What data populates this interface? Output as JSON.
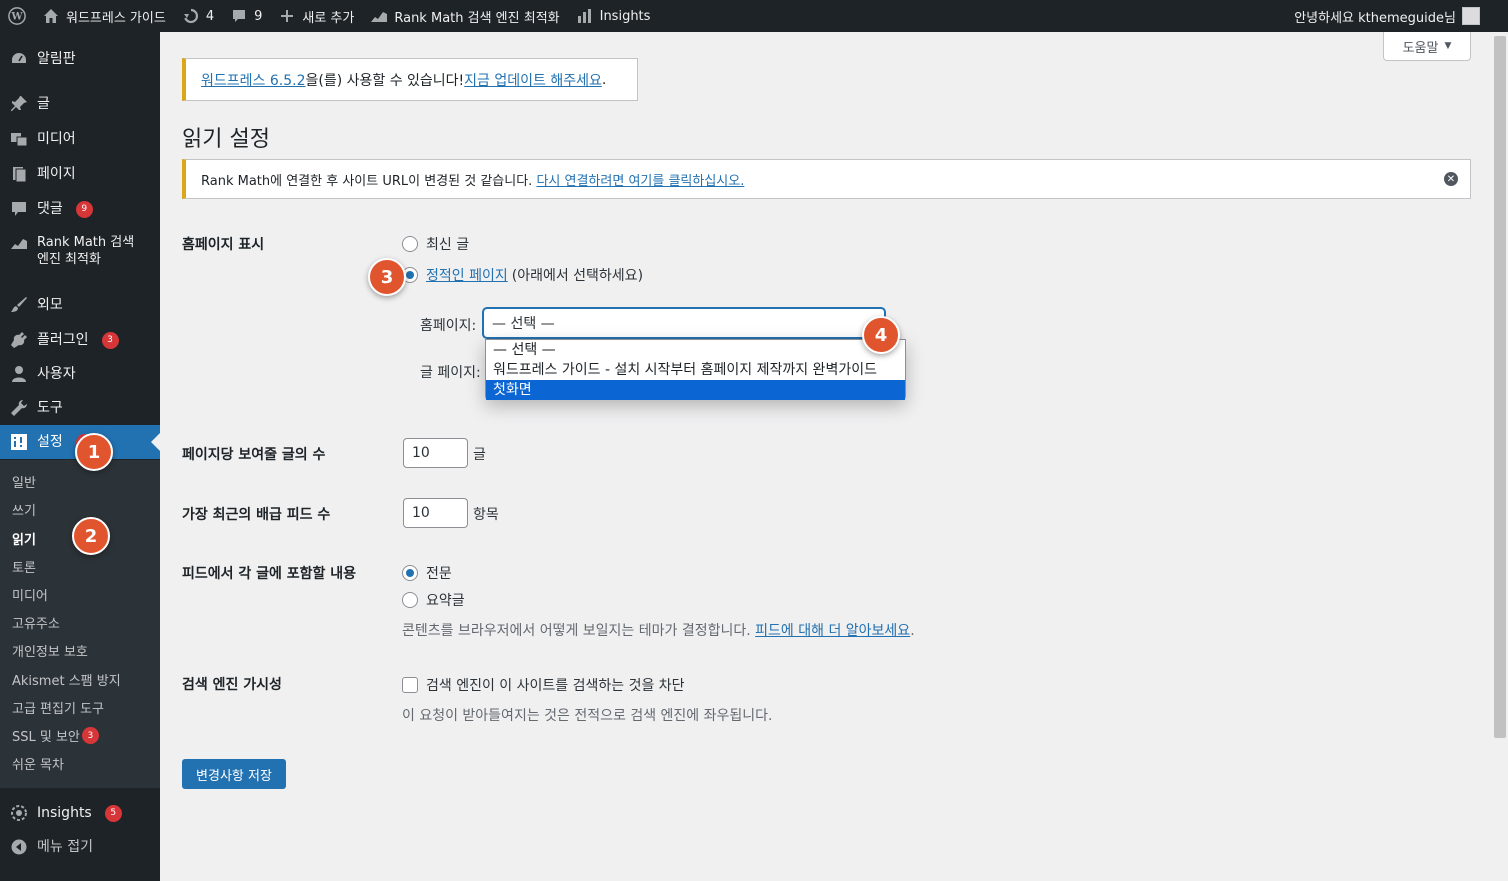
{
  "adminbar": {
    "site_name": "워드프레스 가이드",
    "updates_count": "4",
    "comments_count": "9",
    "new_label": "새로 추가",
    "rankmath_label": "Rank Math 검색 엔진 최적화",
    "insights_label": "Insights",
    "greeting": "안녕하세요 kthemeguide님"
  },
  "sidebar": {
    "items": [
      {
        "label": "알림판",
        "icon": "dashboard-icon"
      },
      {
        "label": "글",
        "icon": "pin-icon"
      },
      {
        "label": "미디어",
        "icon": "media-icon"
      },
      {
        "label": "페이지",
        "icon": "page-icon"
      },
      {
        "label": "댓글",
        "icon": "comment-icon",
        "badge": "9"
      },
      {
        "label": "Rank Math 검색",
        "label2": "엔진 최적화",
        "icon": "rankmath-icon"
      },
      {
        "label": "외모",
        "icon": "brush-icon"
      },
      {
        "label": "플러그인",
        "icon": "plugin-icon",
        "badge": "3"
      },
      {
        "label": "사용자",
        "icon": "user-icon"
      },
      {
        "label": "도구",
        "icon": "wrench-icon"
      },
      {
        "label": "설정",
        "icon": "settings-icon",
        "badge": "3"
      }
    ],
    "submenu": [
      {
        "label": "일반"
      },
      {
        "label": "쓰기"
      },
      {
        "label": "읽기"
      },
      {
        "label": "토론"
      },
      {
        "label": "미디어"
      },
      {
        "label": "고유주소"
      },
      {
        "label": "개인정보 보호"
      },
      {
        "label": "Akismet 스팸 방지"
      },
      {
        "label": "고급 편집기 도구"
      },
      {
        "label": "SSL 및 보안",
        "badge": "3"
      },
      {
        "label": "쉬운 목차"
      }
    ],
    "bottom": [
      {
        "label": "Insights",
        "icon": "insights-icon",
        "badge": "5"
      },
      {
        "label": "메뉴 접기",
        "icon": "collapse-icon"
      }
    ]
  },
  "help_label": "도움말",
  "notices": {
    "update_link": "워드프레스 6.5.2",
    "update_text": "을(를) 사용할 수 있습니다!",
    "update_now": "지금 업데이트 해주세요",
    "update_end": ".",
    "rankmath_text": "Rank Math에 연결한 후 사이트 URL이 변경된 것 같습니다.",
    "rankmath_link": "다시 연결하려면 여기를 클릭하십시오."
  },
  "page_title": "읽기 설정",
  "homepage_display": {
    "label": "홈페이지 표시",
    "option_latest": "최신 글",
    "option_static_link": "정적인 페이지",
    "option_static_note": "(아래에서 선택하세요)",
    "homepage_label": "홈페이지:",
    "homepage_value": "— 선택 —",
    "posts_page_label": "글 페이지:",
    "dropdown_options": [
      "— 선택 —",
      "워드프레스 가이드 - 설치 시작부터 홈페이지 제작까지 완벽가이드",
      "첫화면"
    ],
    "dropdown_selected_index": 2
  },
  "posts_per_page": {
    "label": "페이지당 보여줄 글의 수",
    "value": "10",
    "unit": "글"
  },
  "feed_count": {
    "label": "가장 최근의 배급 피드 수",
    "value": "10",
    "unit": "항목"
  },
  "feed_content": {
    "label": "피드에서 각 글에 포함할 내용",
    "option_full": "전문",
    "option_excerpt": "요약글",
    "desc_text": "콘텐츠를 브라우저에서 어떻게 보일지는 테마가 결정합니다.",
    "desc_link": "피드에 대해 더 알아보세요",
    "desc_end": "."
  },
  "search_visibility": {
    "label": "검색 엔진 가시성",
    "checkbox_label": "검색 엔진이 이 사이트를 검색하는 것을 차단",
    "desc": "이 요청이 받아들여지는 것은 전적으로 검색 엔진에 좌우됩니다."
  },
  "save_button": "변경사항 저장",
  "markers": [
    "1",
    "2",
    "3",
    "4"
  ],
  "colors": {
    "admin_dark": "#1d2327",
    "primary": "#2271b1",
    "marker": "#e0552e",
    "warning": "#dba617"
  }
}
